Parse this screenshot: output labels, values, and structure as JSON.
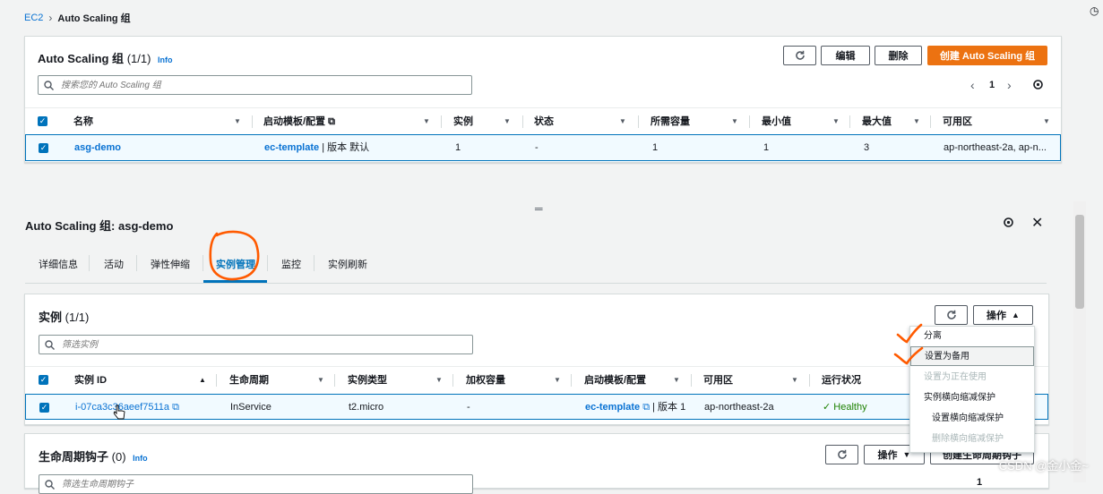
{
  "breadcrumb": {
    "root": "EC2",
    "current": "Auto Scaling 组"
  },
  "asg_panel": {
    "title": "Auto Scaling 组",
    "count": "(1/1)",
    "info": "Info",
    "buttons": {
      "edit": "编辑",
      "delete": "删除",
      "create": "创建 Auto Scaling 组"
    },
    "search_placeholder": "搜索您的 Auto Scaling 组",
    "page": "1",
    "columns": [
      "名称",
      "启动模板/配置",
      "实例",
      "状态",
      "所需容量",
      "最小值",
      "最大值",
      "可用区"
    ],
    "row": {
      "name": "asg-demo",
      "template": "ec-template",
      "template_version": "| 版本 默认",
      "instances": "1",
      "status": "-",
      "desired": "1",
      "min": "1",
      "max": "3",
      "az": "ap-northeast-2a, ap-n..."
    }
  },
  "detail": {
    "title": "Auto Scaling 组: asg-demo",
    "tabs": [
      "详细信息",
      "活动",
      "弹性伸缩",
      "实例管理",
      "监控",
      "实例刷新"
    ],
    "active_tab": "实例管理"
  },
  "instances_panel": {
    "title": "实例",
    "count": "(1/1)",
    "actions_label": "操作",
    "search_placeholder": "筛选实例",
    "columns": [
      "实例 ID",
      "生命周期",
      "实例类型",
      "加权容量",
      "启动模板/配置",
      "可用区",
      "运行状况"
    ],
    "row": {
      "id": "i-07ca3c36aeef7511a",
      "lifecycle": "InService",
      "type": "t2.micro",
      "weight": "-",
      "template": "ec-template",
      "template_version": "| 版本 1",
      "az": "ap-northeast-2a",
      "health": "Healthy"
    }
  },
  "actions_menu": {
    "items": [
      {
        "label": "分离",
        "state": "normal"
      },
      {
        "label": "设置为备用",
        "state": "highlighted"
      },
      {
        "label": "设置为正在使用",
        "state": "disabled"
      },
      {
        "label": "实例横向缩减保护",
        "state": "normal"
      },
      {
        "label": "设置横向缩减保护",
        "state": "normal"
      },
      {
        "label": "删除横向缩减保护",
        "state": "disabled"
      }
    ]
  },
  "hooks_panel": {
    "title": "生命周期钩子",
    "count": "(0)",
    "info": "Info",
    "actions_label": "操作",
    "create_label": "创建生命周期钩子",
    "search_placeholder": "筛选生命周期钩子",
    "page": "1"
  },
  "watermark": "CSDN @金小金~",
  "colors": {
    "link": "#0972d3",
    "primary": "#ec7211",
    "annotation": "#ff5a00",
    "success": "#1d8102"
  },
  "icons": [
    "chevron-right-icon",
    "external-link-icon",
    "refresh-icon",
    "search-icon",
    "settings-icon",
    "close-icon",
    "sort-icon",
    "check-circle-icon",
    "checkbox-icon",
    "caret-up-icon",
    "caret-down-icon"
  ]
}
